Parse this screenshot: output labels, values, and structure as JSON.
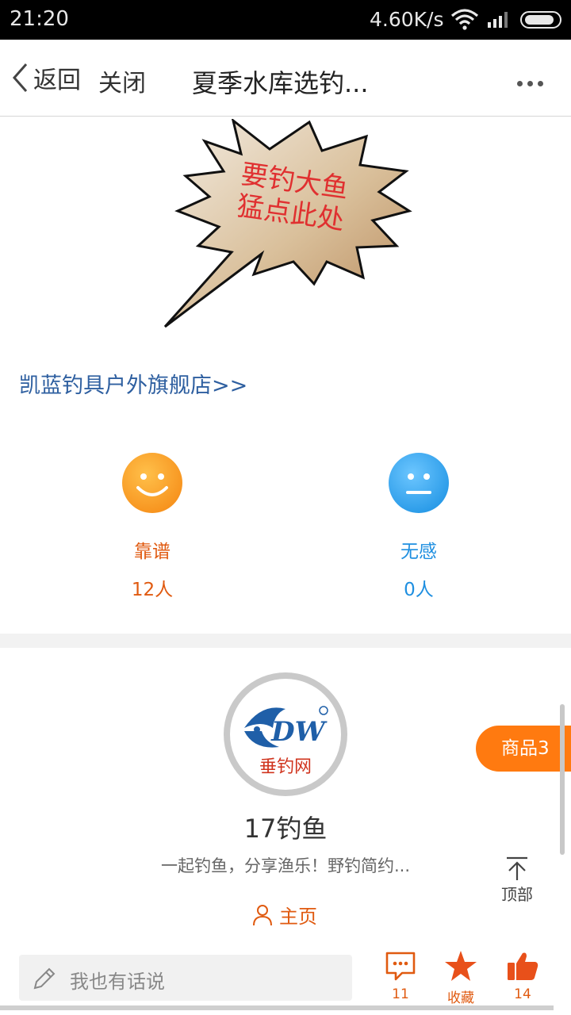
{
  "status_bar": {
    "time": "21:20",
    "net_speed": "4.60K/s"
  },
  "nav": {
    "back_label": "返回",
    "close_label": "关闭",
    "title": "夏季水库选钓...",
    "more_icon": "more-dots-icon"
  },
  "promo": {
    "burst_line1": "要钓大鱼",
    "burst_line2": "猛点此处"
  },
  "store_link": "凯蓝钓具户外旗舰店>>",
  "ratings": {
    "good": {
      "label": "靠谱",
      "count": "12人",
      "color": "#e05a10"
    },
    "neutral": {
      "label": "无感",
      "count": "0人",
      "color": "#1f8fe0"
    }
  },
  "author": {
    "logo_text_main": "DW",
    "logo_text_sub": "垂钓网",
    "name": "17钓鱼",
    "desc": "一起钓鱼，分享渔乐！野钓简约...",
    "homepage_label": "主页"
  },
  "side": {
    "goods_label": "商品3",
    "top_label": "顶部"
  },
  "bottom": {
    "comment_placeholder": "我也有话说",
    "comment_count": "11",
    "fav_label": "收藏",
    "like_count": "14"
  },
  "colors": {
    "accent": "#ff7a10",
    "orange_text": "#e05a10",
    "blue_text": "#1f8fe0",
    "link": "#2e5fa0"
  }
}
